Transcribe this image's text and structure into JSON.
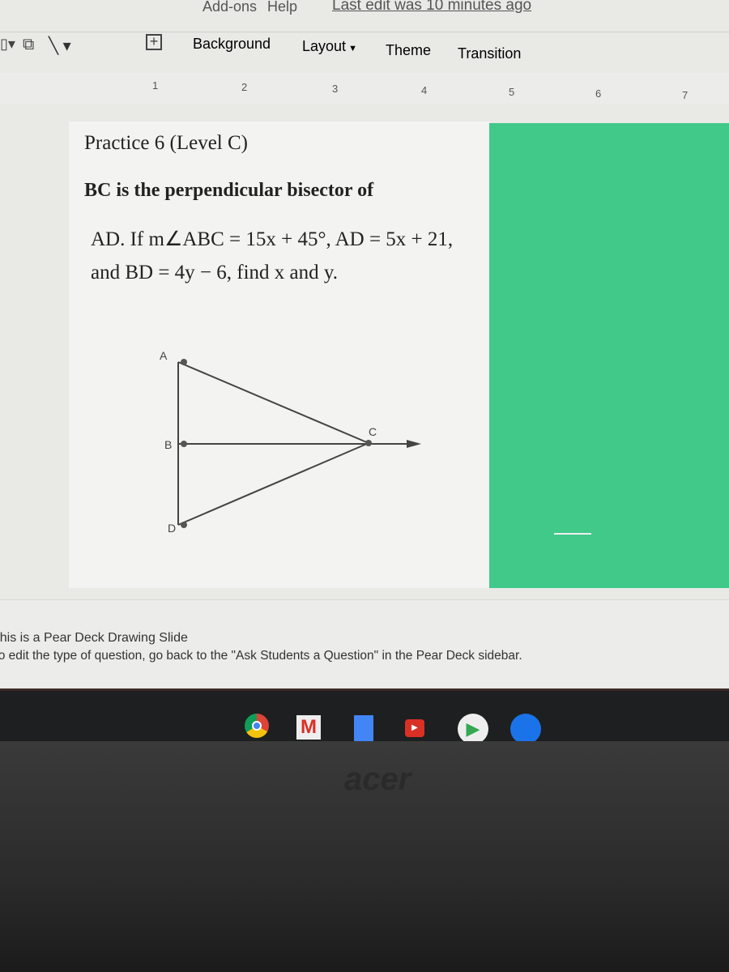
{
  "menu": {
    "partial_items": [
      "Add-ons",
      "Help"
    ],
    "last_edit": "Last edit was 10 minutes ago"
  },
  "toolbar": {
    "background": "Background",
    "layout": "Layout",
    "theme": "Theme",
    "transition": "Transition"
  },
  "ruler": [
    "1",
    "2",
    "3",
    "4",
    "5",
    "6",
    "7"
  ],
  "slide": {
    "title": "Practice 6 (Level C)",
    "line1": "BC is the perpendicular bisector of",
    "line2": "AD. If m∠ABC = 15x + 45°, AD = 5x + 21,",
    "line3": "and BD = 4y − 6, find x and y.",
    "labels": {
      "a": "A",
      "b": "B",
      "c": "C",
      "d": "D"
    },
    "side_color": "#41c98a"
  },
  "notes": {
    "line1": "This is a Pear Deck Drawing Slide",
    "line2": "To edit the type of question, go back to the \"Ask Students a Question\" in the Pear Deck sidebar."
  },
  "shelf": {
    "apps": [
      "chrome",
      "gmail",
      "docs",
      "youtube",
      "play-store",
      "files"
    ]
  },
  "brand": "acer"
}
